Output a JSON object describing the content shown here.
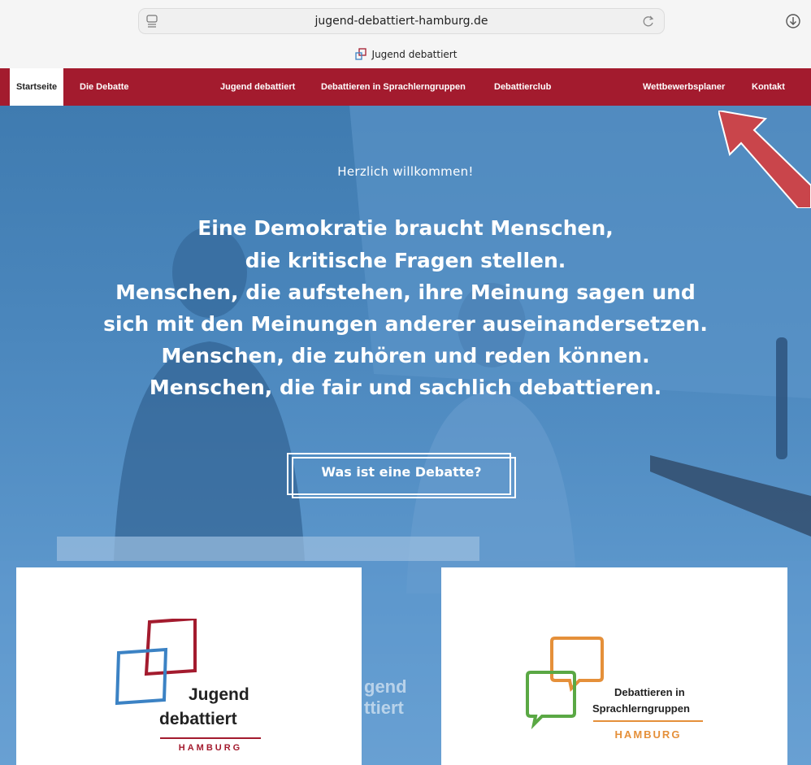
{
  "browser": {
    "url": "jugend-debattiert-hamburg.de",
    "tab_title": "Jugend debattiert"
  },
  "nav": {
    "items": [
      {
        "label": "Startseite",
        "active": true
      },
      {
        "label": "Die Debatte"
      },
      {
        "label": "Jugend debattiert"
      },
      {
        "label": "Debattieren in Sprachlerngruppen"
      },
      {
        "label": "Debattierclub"
      },
      {
        "label": "Wettbewerbsplaner"
      },
      {
        "label": "Kontakt"
      }
    ]
  },
  "hero": {
    "greeting": "Herzlich willkommen!",
    "headline_lines": [
      "Eine Demokratie braucht Menschen,",
      "die kritische Fragen stellen.",
      "Menschen, die aufstehen, ihre Meinung sagen und",
      "sich mit den Meinungen anderer auseinandersetzen.",
      "Menschen, die zuhören und reden können.",
      "Menschen, die fair und sachlich debattieren."
    ],
    "cta_label": "Was ist eine Debatte?",
    "background_sign": "gend\nttiert"
  },
  "cards": {
    "left": {
      "logo_word_1": "Jugend",
      "logo_word_2": "debattiert",
      "logo_city": "HAMBURG"
    },
    "right": {
      "logo_line_1": "Debattieren in",
      "logo_line_2": "Sprachlerngruppen",
      "logo_city": "HAMBURG"
    }
  },
  "colors": {
    "brand_red": "#a31b2e",
    "brand_blue": "#3b82c4",
    "orange": "#e5903a",
    "green": "#5aa844",
    "hero_blue": "#4b87bd",
    "arrow": "#c9454b"
  }
}
